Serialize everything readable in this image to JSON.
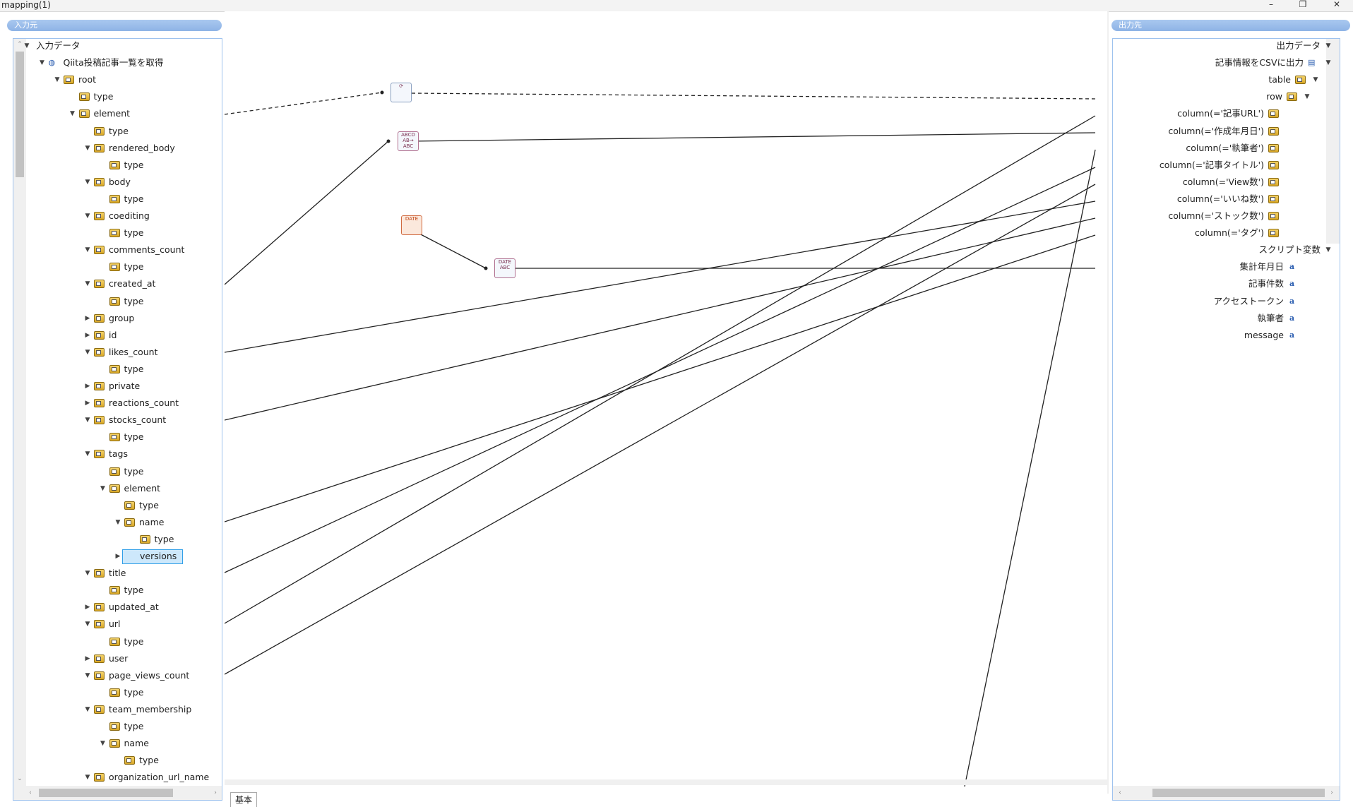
{
  "window": {
    "title": "mapping(1)",
    "minimize": "–",
    "restore": "❐",
    "close": "✕"
  },
  "left_panel": {
    "header": "入力元",
    "nodes": [
      {
        "label": "入力データ",
        "level": 0,
        "toggle": "down",
        "icon": "none"
      },
      {
        "label": "Qiita投稿記事一覧を取得",
        "level": 1,
        "toggle": "down",
        "icon": "globe"
      },
      {
        "label": "root",
        "level": 2,
        "toggle": "down",
        "icon": "folder"
      },
      {
        "label": "type",
        "level": 3,
        "toggle": "none",
        "icon": "folder"
      },
      {
        "label": "element",
        "level": 3,
        "toggle": "down",
        "icon": "folder"
      },
      {
        "label": "type",
        "level": 4,
        "toggle": "none",
        "icon": "folder"
      },
      {
        "label": "rendered_body",
        "level": 4,
        "toggle": "down",
        "icon": "folder"
      },
      {
        "label": "type",
        "level": 5,
        "toggle": "none",
        "icon": "folder"
      },
      {
        "label": "body",
        "level": 4,
        "toggle": "down",
        "icon": "folder"
      },
      {
        "label": "type",
        "level": 5,
        "toggle": "none",
        "icon": "folder"
      },
      {
        "label": "coediting",
        "level": 4,
        "toggle": "down",
        "icon": "folder"
      },
      {
        "label": "type",
        "level": 5,
        "toggle": "none",
        "icon": "folder"
      },
      {
        "label": "comments_count",
        "level": 4,
        "toggle": "down",
        "icon": "folder"
      },
      {
        "label": "type",
        "level": 5,
        "toggle": "none",
        "icon": "folder"
      },
      {
        "label": "created_at",
        "level": 4,
        "toggle": "down",
        "icon": "folder"
      },
      {
        "label": "type",
        "level": 5,
        "toggle": "none",
        "icon": "folder"
      },
      {
        "label": "group",
        "level": 4,
        "toggle": "right",
        "icon": "folder"
      },
      {
        "label": "id",
        "level": 4,
        "toggle": "right",
        "icon": "folder"
      },
      {
        "label": "likes_count",
        "level": 4,
        "toggle": "down",
        "icon": "folder"
      },
      {
        "label": "type",
        "level": 5,
        "toggle": "none",
        "icon": "folder"
      },
      {
        "label": "private",
        "level": 4,
        "toggle": "right",
        "icon": "folder"
      },
      {
        "label": "reactions_count",
        "level": 4,
        "toggle": "right",
        "icon": "folder"
      },
      {
        "label": "stocks_count",
        "level": 4,
        "toggle": "down",
        "icon": "folder"
      },
      {
        "label": "type",
        "level": 5,
        "toggle": "none",
        "icon": "folder"
      },
      {
        "label": "tags",
        "level": 4,
        "toggle": "down",
        "icon": "folder"
      },
      {
        "label": "type",
        "level": 5,
        "toggle": "none",
        "icon": "folder"
      },
      {
        "label": "element",
        "level": 5,
        "toggle": "down",
        "icon": "folder"
      },
      {
        "label": "type",
        "level": 6,
        "toggle": "none",
        "icon": "folder"
      },
      {
        "label": "name",
        "level": 6,
        "toggle": "down",
        "icon": "folder"
      },
      {
        "label": "type",
        "level": 7,
        "toggle": "none",
        "icon": "folder"
      },
      {
        "label": "versions",
        "level": 6,
        "toggle": "right",
        "icon": "folder",
        "selected": true
      },
      {
        "label": "title",
        "level": 4,
        "toggle": "down",
        "icon": "folder"
      },
      {
        "label": "type",
        "level": 5,
        "toggle": "none",
        "icon": "folder"
      },
      {
        "label": "updated_at",
        "level": 4,
        "toggle": "right",
        "icon": "folder"
      },
      {
        "label": "url",
        "level": 4,
        "toggle": "down",
        "icon": "folder"
      },
      {
        "label": "type",
        "level": 5,
        "toggle": "none",
        "icon": "folder"
      },
      {
        "label": "user",
        "level": 4,
        "toggle": "right",
        "icon": "folder"
      },
      {
        "label": "page_views_count",
        "level": 4,
        "toggle": "down",
        "icon": "folder"
      },
      {
        "label": "type",
        "level": 5,
        "toggle": "none",
        "icon": "folder"
      },
      {
        "label": "team_membership",
        "level": 4,
        "toggle": "down",
        "icon": "folder"
      },
      {
        "label": "type",
        "level": 5,
        "toggle": "none",
        "icon": "folder"
      },
      {
        "label": "name",
        "level": 5,
        "toggle": "down",
        "icon": "folder"
      },
      {
        "label": "type",
        "level": 6,
        "toggle": "none",
        "icon": "folder"
      },
      {
        "label": "organization_url_name",
        "level": 4,
        "toggle": "down",
        "icon": "folder"
      }
    ]
  },
  "right_panel": {
    "header": "出力先",
    "nodes": [
      {
        "label": "出力データ",
        "toggle": "down",
        "icon": "none"
      },
      {
        "label": "記事情報をCSVに出力",
        "toggle": "down",
        "icon": "csv"
      },
      {
        "label": "table",
        "toggle": "down",
        "icon": "folder"
      },
      {
        "label": "row",
        "toggle": "down",
        "icon": "folder"
      },
      {
        "label": "column(='記事URL')",
        "toggle": "none",
        "icon": "folder"
      },
      {
        "label": "column(='作成年月日')",
        "toggle": "none",
        "icon": "folder"
      },
      {
        "label": "column(='執筆者')",
        "toggle": "none",
        "icon": "folder"
      },
      {
        "label": "column(='記事タイトル')",
        "toggle": "none",
        "icon": "folder"
      },
      {
        "label": "column(='View数')",
        "toggle": "none",
        "icon": "folder"
      },
      {
        "label": "column(='いいね数')",
        "toggle": "none",
        "icon": "folder"
      },
      {
        "label": "column(='ストック数')",
        "toggle": "none",
        "icon": "folder"
      },
      {
        "label": "column(='タグ')",
        "toggle": "none",
        "icon": "folder"
      },
      {
        "label": "スクリプト変数",
        "toggle": "down",
        "icon": "none"
      },
      {
        "label": "集計年月日",
        "toggle": "none",
        "icon": "var"
      },
      {
        "label": "記事件数",
        "toggle": "none",
        "icon": "var"
      },
      {
        "label": "アクセストークン",
        "toggle": "none",
        "icon": "var"
      },
      {
        "label": "執筆者",
        "toggle": "none",
        "icon": "var"
      },
      {
        "label": "message",
        "toggle": "none",
        "icon": "var"
      }
    ]
  },
  "functions": [
    {
      "name": "loop-function",
      "text": "⟳"
    },
    {
      "name": "string-function",
      "text": "ABCD AB→ ABC"
    },
    {
      "name": "date-function",
      "text": "DATE"
    },
    {
      "name": "date-format-function",
      "text": "DATE ABC"
    }
  ],
  "bottom_tab": {
    "label": "基本"
  }
}
